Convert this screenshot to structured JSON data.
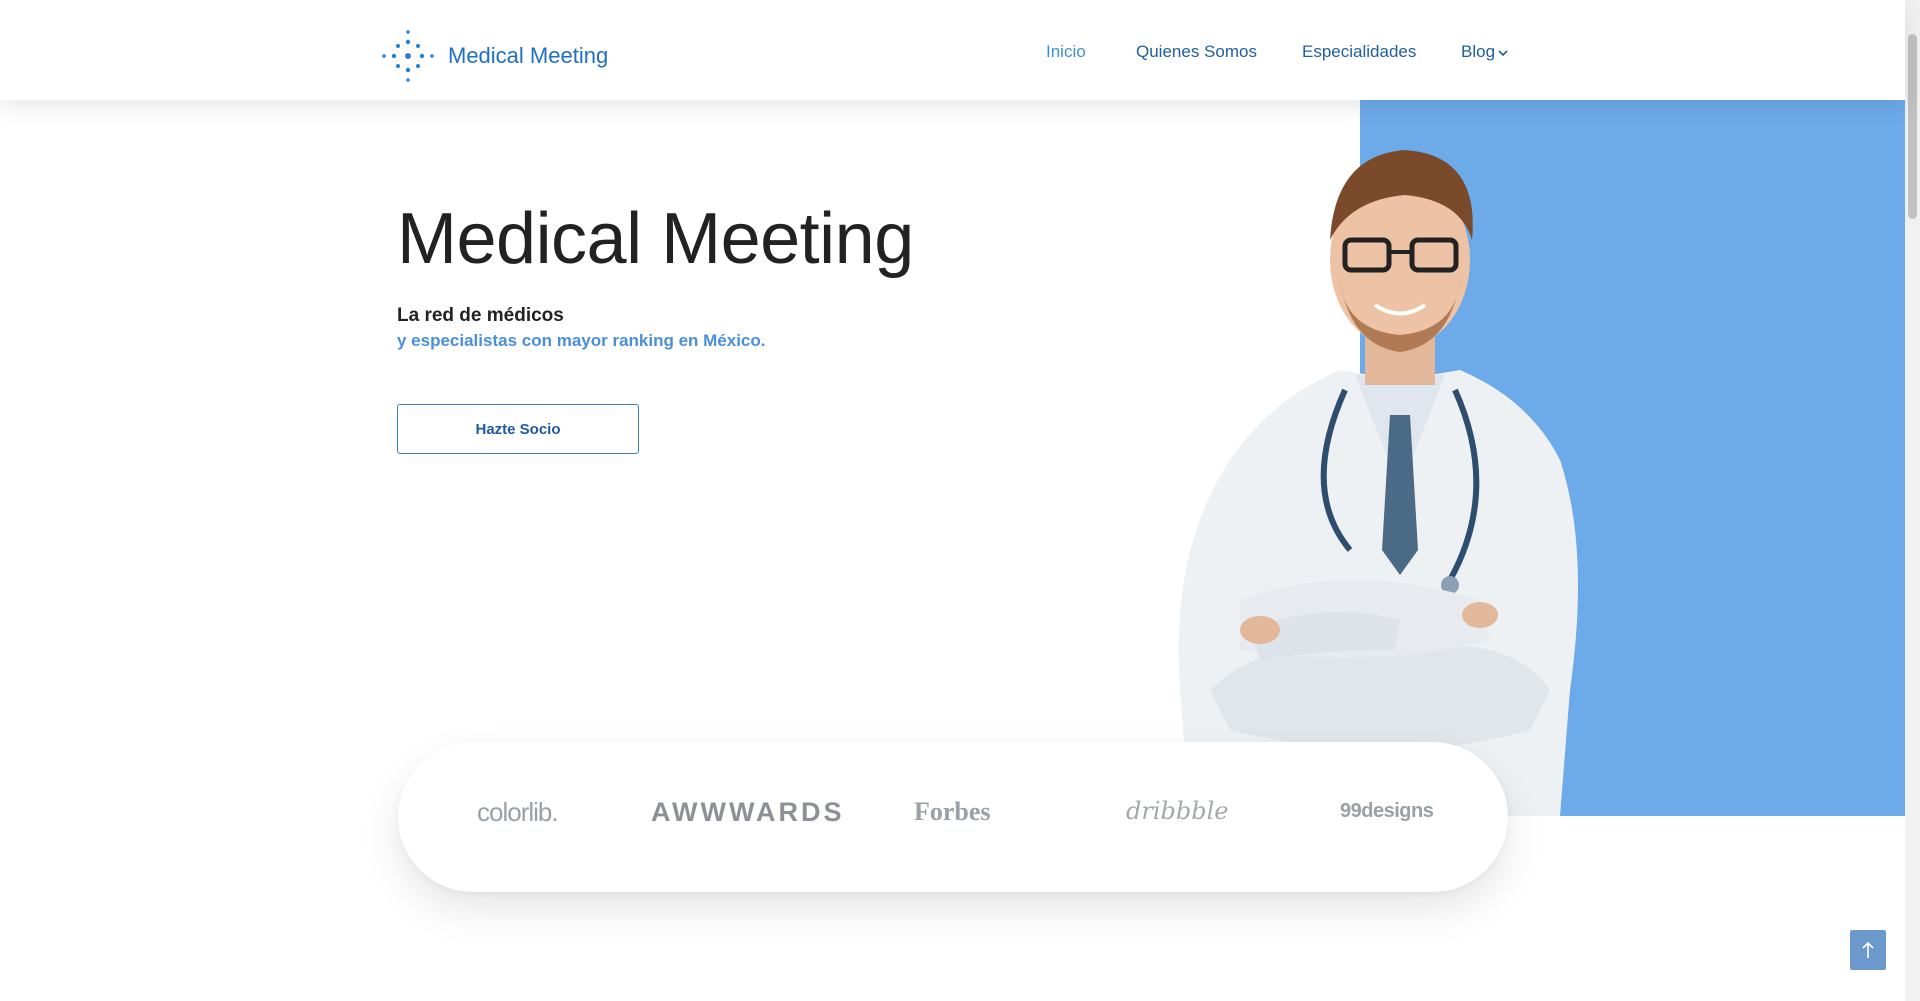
{
  "brand": {
    "name": "Medical Meeting",
    "logo_icon": "dotted-circle-logo-icon",
    "color": "#1f6fc4"
  },
  "nav": {
    "items": [
      {
        "label": "Inicio",
        "active": true
      },
      {
        "label": "Quienes Somos",
        "active": false
      },
      {
        "label": "Especialidades",
        "active": false
      },
      {
        "label": "Blog",
        "active": false,
        "icon": "chevron-down-icon"
      }
    ]
  },
  "hero": {
    "title": "Medical Meeting",
    "tagline_line1": "La red de médicos",
    "tagline_line2": "y especialistas con mayor ranking en México.",
    "cta_label": "Hazte Socio",
    "accent_color": "#6daaea"
  },
  "partners": {
    "logos": [
      "colorlib.",
      "AWWWARDS",
      "Forbes",
      "dribbble",
      "99designs"
    ]
  },
  "back_to_top": {
    "icon": "arrow-up-icon"
  }
}
